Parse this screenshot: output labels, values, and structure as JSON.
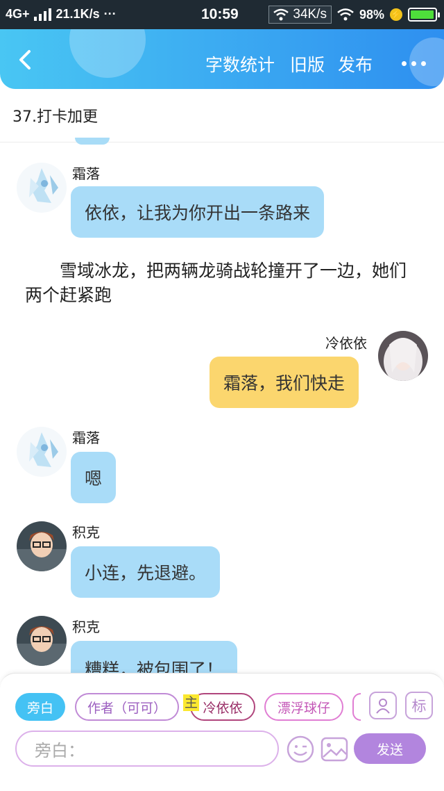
{
  "status_bar": {
    "network": "4G+",
    "speed_left": "21.1K/s",
    "dots": "···",
    "time": "10:59",
    "speed_box": "34K/s",
    "battery_percent": "98%",
    "battery_level": 0.98
  },
  "header": {
    "back_icon": "chevron-left-icon",
    "word_count": "字数统计",
    "old_version": "旧版",
    "publish": "发布",
    "more_icon": "more-dots-icon"
  },
  "chapter_title": "37.打卡加更",
  "messages": [
    {
      "speaker": "霜落",
      "text": "依依，让我为你开出一条路来"
    },
    {
      "narration": "雪域冰龙，把两辆龙骑战轮撞开了一边，她们两个赶紧跑"
    },
    {
      "speaker": "冷依依",
      "text": "霜落，我们快走"
    },
    {
      "speaker": "霜落",
      "text": "嗯"
    },
    {
      "speaker": "积克",
      "text": "小连，先退避。"
    },
    {
      "speaker": "积克",
      "text": "糟糕，被包围了！"
    }
  ],
  "composer": {
    "chips": [
      "旁白",
      "作者（可可）",
      "冷依依",
      "漂浮球仔"
    ],
    "main_tag": "主",
    "badge_label": "标",
    "placeholder": "旁白：",
    "send": "发送",
    "colors": {
      "active": "#44c2f4",
      "send": "#b285de"
    }
  }
}
